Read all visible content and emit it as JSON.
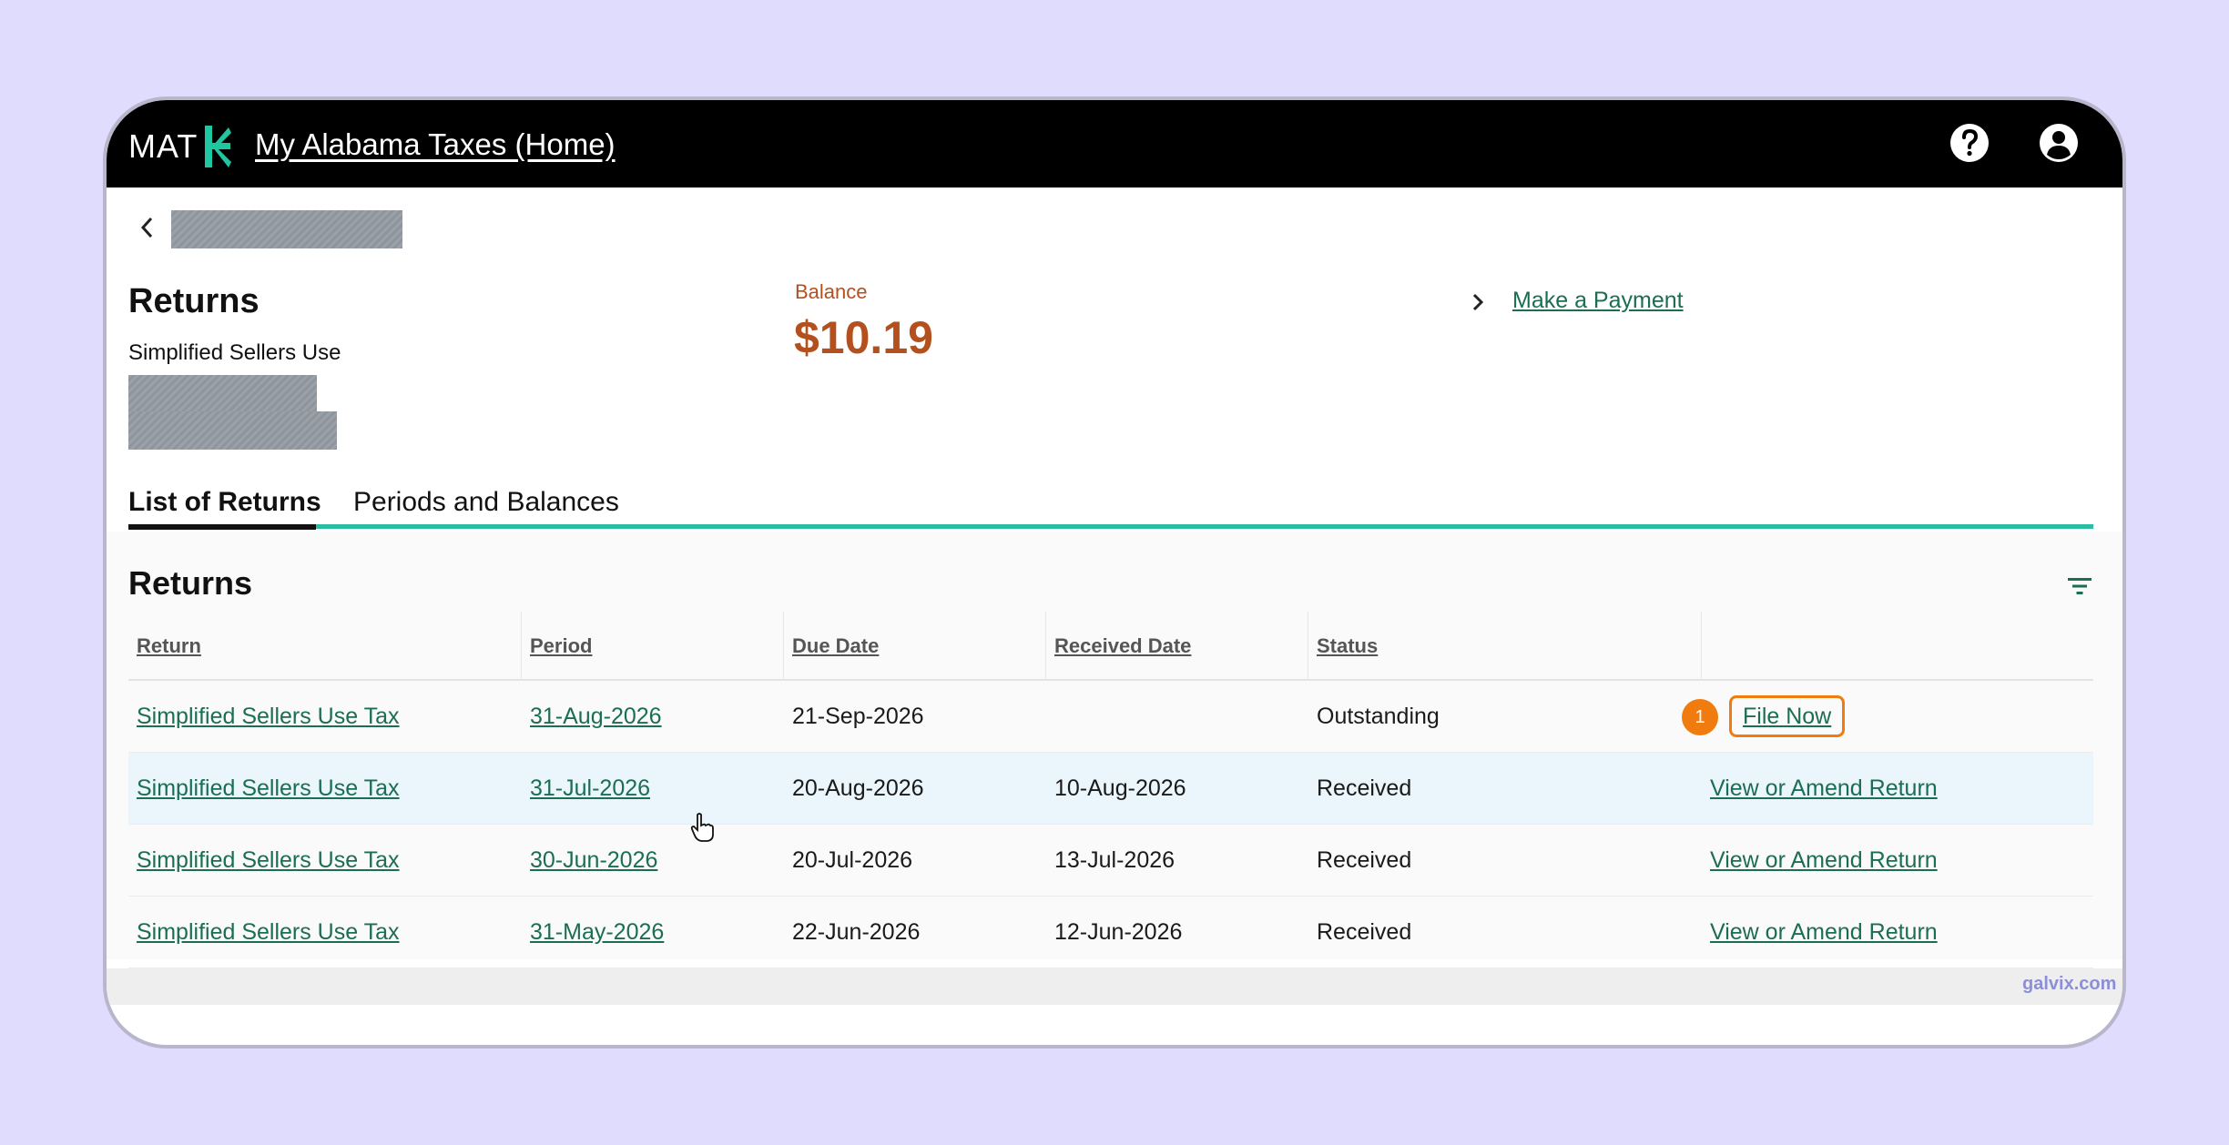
{
  "colors": {
    "page_bg": "#e0dcfe",
    "topbar_bg": "#000000",
    "brand_accent": "#1fc7a0",
    "balance": "#b3501e",
    "link": "#1b6e52",
    "tab_line": "#2bbda2",
    "highlight": "#f07c0f",
    "row_hover": "#eaf5fc"
  },
  "topbar": {
    "logo_text": "MAT",
    "logo_icon": "mat-k-logo-icon",
    "home_link": "My Alabama Taxes (Home)",
    "help_icon": "question-circle-icon",
    "account_icon": "user-circle-icon"
  },
  "header": {
    "back_icon": "chevron-left-icon",
    "title": "Returns",
    "subtitle": "Simplified Sellers Use",
    "balance_label": "Balance",
    "balance_value": "$10.19",
    "payment_icon": "chevron-right-icon",
    "payment_link": "Make a Payment"
  },
  "tabs": [
    {
      "label": "List of Returns",
      "active": true
    },
    {
      "label": "Periods and Balances",
      "active": false
    }
  ],
  "returns": {
    "title": "Returns",
    "filter_icon": "filter-icon",
    "columns": [
      "Return",
      "Period",
      "Due Date",
      "Received Date",
      "Status",
      ""
    ],
    "rows": [
      {
        "return": "Simplified Sellers Use Tax",
        "period": "31-Aug-2026",
        "due": "21-Sep-2026",
        "received": "",
        "status": "Outstanding",
        "action": "File Now",
        "step": "1"
      },
      {
        "return": "Simplified Sellers Use Tax",
        "period": "31-Jul-2026",
        "due": "20-Aug-2026",
        "received": "10-Aug-2026",
        "status": "Received",
        "action": "View or Amend Return"
      },
      {
        "return": "Simplified Sellers Use Tax",
        "period": "30-Jun-2026",
        "due": "20-Jul-2026",
        "received": "13-Jul-2026",
        "status": "Received",
        "action": "View or Amend Return"
      },
      {
        "return": "Simplified Sellers Use Tax",
        "period": "31-May-2026",
        "due": "22-Jun-2026",
        "received": "12-Jun-2026",
        "status": "Received",
        "action": "View or Amend Return"
      }
    ]
  },
  "cursor_icon": "hand-pointer-icon",
  "watermark": "galvix.com"
}
